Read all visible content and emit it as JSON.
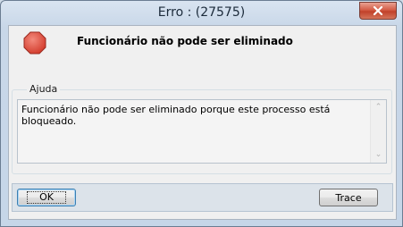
{
  "window": {
    "title": "Erro : (27575)"
  },
  "header": {
    "message": "Funcionário não pode ser eliminado",
    "icon": "stop-icon"
  },
  "help_group": {
    "legend": "Ajuda",
    "text": "Funcionário não pode ser eliminado porque este processo está bloqueado."
  },
  "buttons": {
    "ok_label": "OK",
    "trace_label": "Trace"
  },
  "colors": {
    "stop_icon": "#e04a3b",
    "close_button": "#c84a36"
  }
}
